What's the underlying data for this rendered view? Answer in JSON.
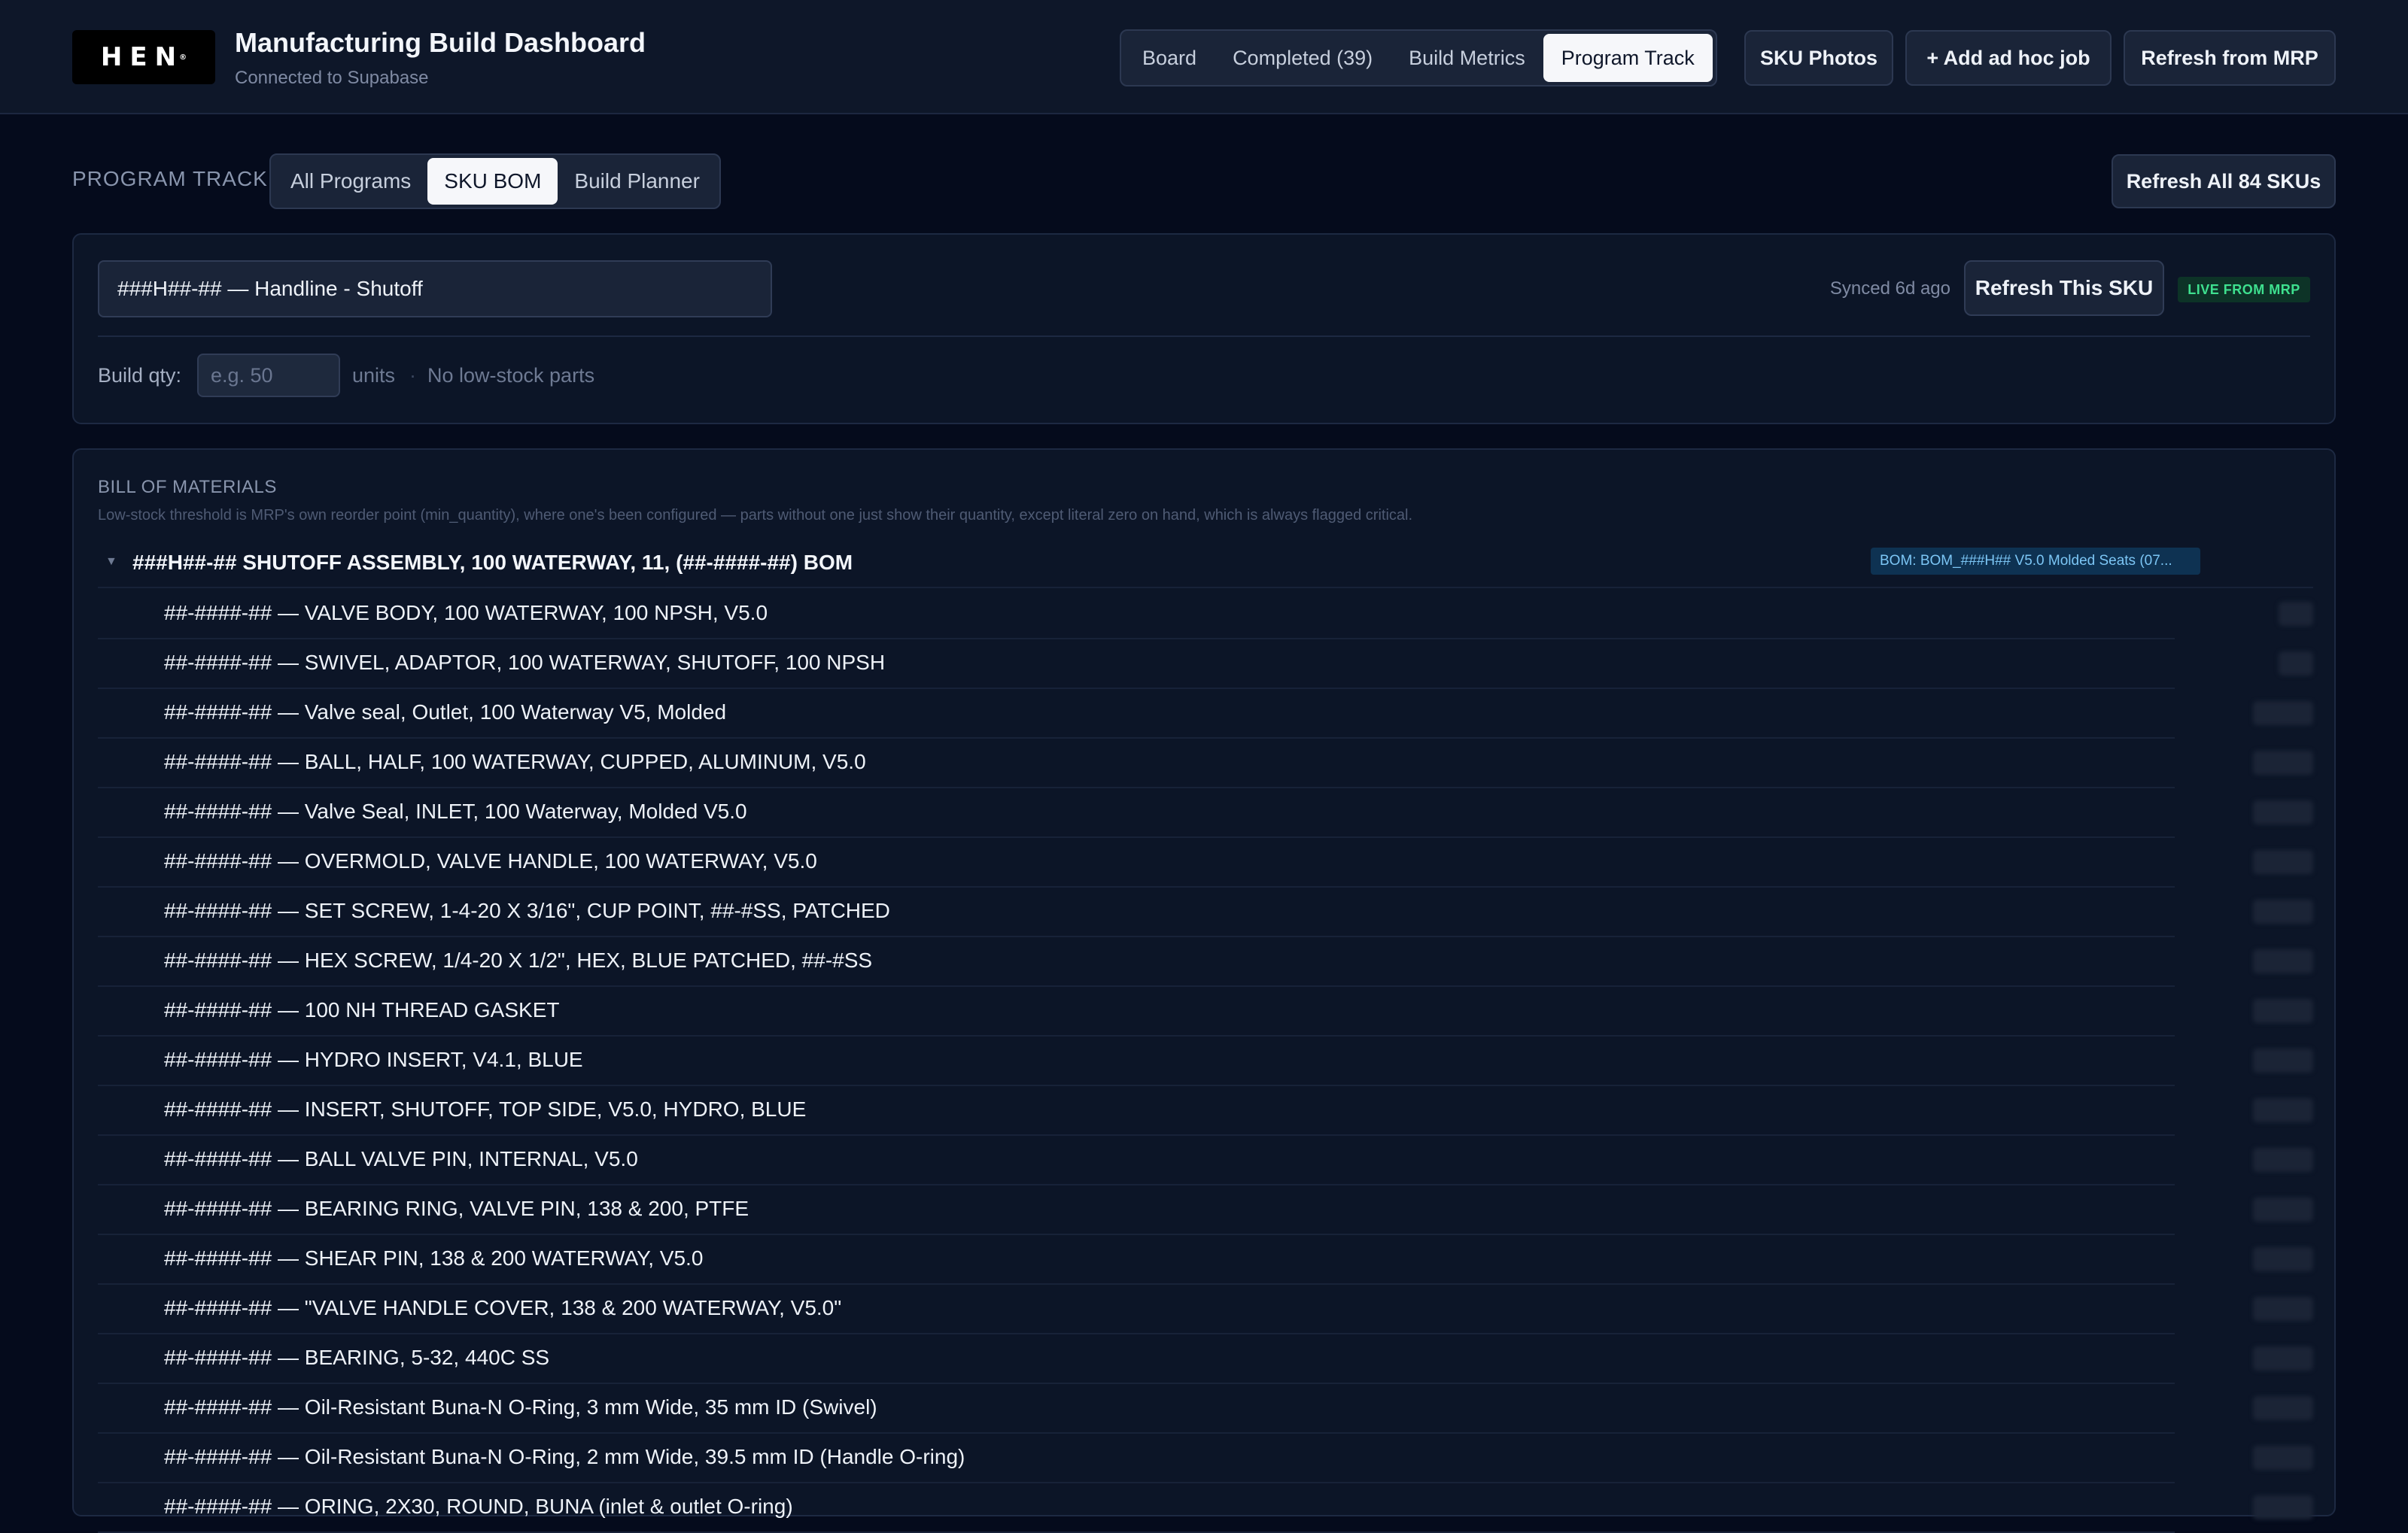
{
  "header": {
    "logo_text": "HEN",
    "title": "Manufacturing Build Dashboard",
    "subtitle": "Connected to Supabase",
    "tabs": [
      {
        "label": "Board",
        "active": false
      },
      {
        "label": "Completed (39)",
        "active": false
      },
      {
        "label": "Build Metrics",
        "active": false
      },
      {
        "label": "Program Track",
        "active": true
      }
    ],
    "sku_photos_label": "SKU Photos",
    "add_job_label": "+ Add ad hoc job",
    "refresh_mrp_label": "Refresh from MRP"
  },
  "program_track": {
    "label": "PROGRAM TRACK",
    "tabs": [
      {
        "label": "All Programs",
        "active": false
      },
      {
        "label": "SKU BOM",
        "active": true
      },
      {
        "label": "Build Planner",
        "active": false
      }
    ],
    "refresh_all_label": "Refresh All 84 SKUs"
  },
  "sku": {
    "selected": "###H##-## — Handline - Shutoff",
    "synced": "Synced 6d ago",
    "refresh_label": "Refresh This SKU",
    "live_badge": "LIVE FROM MRP",
    "build_qty_label": "Build qty:",
    "build_qty_placeholder": "e.g. 50",
    "units_label": "units",
    "separator": "·",
    "stock_status": "No low-stock parts"
  },
  "bom": {
    "heading": "BILL OF MATERIALS",
    "note": "Low-stock threshold is MRP's own reorder point (min_quantity), where one's been configured — parts without one just show their quantity, except literal zero on hand, which is always flagged critical.",
    "root_caret": "▼",
    "root_label": "###H##-## SHUTOFF ASSEMBLY, 100 WATERWAY, 11, (##-####-##) BOM",
    "bom_tag": "BOM: BOM_###H## V5.0 Molded Seats (07...",
    "rows": [
      "##-####-## — VALVE BODY, 100 WATERWAY, 100 NPSH, V5.0",
      "##-####-## — SWIVEL, ADAPTOR, 100 WATERWAY, SHUTOFF, 100 NPSH",
      "##-####-## — Valve seal, Outlet, 100 Waterway V5, Molded",
      "##-####-## — BALL, HALF, 100 WATERWAY, CUPPED, ALUMINUM, V5.0",
      "##-####-## — Valve Seal, INLET, 100 Waterway, Molded V5.0",
      "##-####-## — OVERMOLD, VALVE HANDLE, 100 WATERWAY, V5.0",
      "##-####-## — SET SCREW, 1-4-20 X 3/16\", CUP POINT, ##-#SS, PATCHED",
      "##-####-## — HEX SCREW, 1/4-20 X 1/2\", HEX, BLUE PATCHED, ##-#SS",
      "##-####-## — 100 NH THREAD GASKET",
      "##-####-## — HYDRO INSERT, V4.1, BLUE",
      "##-####-## — INSERT, SHUTOFF, TOP SIDE, V5.0, HYDRO, BLUE",
      "##-####-## — BALL VALVE PIN, INTERNAL, V5.0",
      "##-####-## — BEARING RING, VALVE PIN, 138 & 200, PTFE",
      "##-####-## — SHEAR PIN, 138 & 200 WATERWAY, V5.0",
      "##-####-## — \"VALVE HANDLE COVER, 138 & 200 WATERWAY, V5.0\"",
      "##-####-## — BEARING, 5-32, 440C SS",
      "##-####-## — Oil-Resistant Buna-N O-Ring, 3 mm Wide, 35 mm ID (Swivel)",
      "##-####-## — Oil-Resistant Buna-N O-Ring, 2 mm Wide, 39.5 mm ID (Handle O-ring)",
      "##-####-## — ORING, 2X30, ROUND, BUNA (inlet & outlet O-ring)"
    ]
  },
  "colors": {
    "background": "#050b1c",
    "header_bg": "#0e1729",
    "active_tab": "#f6f7fa",
    "live_badge": "#3ee08f",
    "bom_tag": "#7cc6f5"
  }
}
